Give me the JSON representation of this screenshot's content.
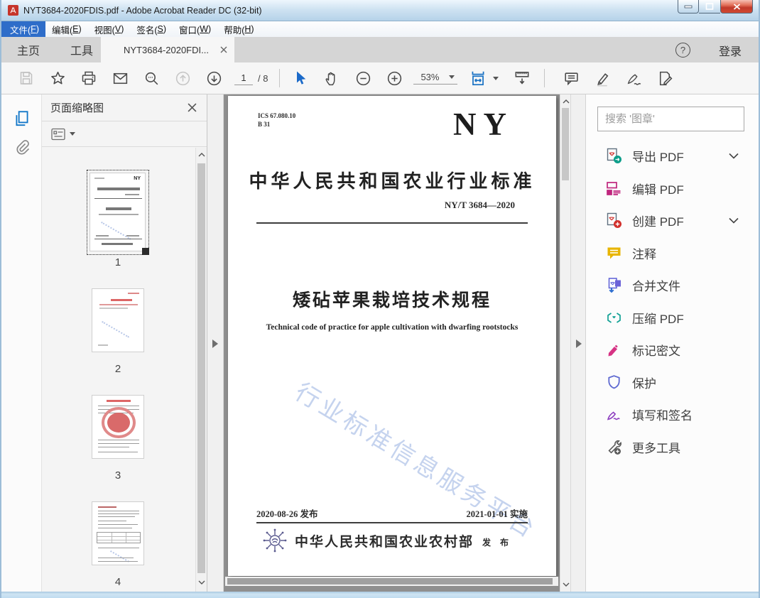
{
  "window": {
    "title": "NYT3684-2020FDIS.pdf - Adobe Acrobat Reader DC (32-bit)"
  },
  "menu": {
    "items": [
      {
        "pre": "文件(",
        "key": "F",
        "post": ")"
      },
      {
        "pre": "编辑(",
        "key": "E",
        "post": ")"
      },
      {
        "pre": "视图(",
        "key": "V",
        "post": ")"
      },
      {
        "pre": "签名(",
        "key": "S",
        "post": ")"
      },
      {
        "pre": "窗口(",
        "key": "W",
        "post": ")"
      },
      {
        "pre": "帮助(",
        "key": "H",
        "post": ")"
      }
    ]
  },
  "tabbar": {
    "home": "主页",
    "tools": "工具",
    "document_tab": "NYT3684-2020FDI...",
    "help_glyph": "?",
    "sign_in": "登录"
  },
  "toolbar": {
    "page_current": "1",
    "page_total": "/ 8",
    "zoom_level": "53%"
  },
  "left_panel": {
    "title": "页面缩略图",
    "thumbnails": [
      {
        "num": "1"
      },
      {
        "num": "2"
      },
      {
        "num": "3"
      },
      {
        "num": "4"
      }
    ]
  },
  "document_page": {
    "ics_line1": "ICS 67.080.10",
    "ics_line2": "B 31",
    "logo": "NY",
    "standard_heading": "中华人民共和国农业行业标准",
    "standard_number": "NY/T 3684—2020",
    "title_cn": "矮砧苹果栽培技术规程",
    "title_en": "Technical code of practice for apple cultivation with dwarfing rootstocks",
    "watermark": "行业标准信息服务平台",
    "issue_date": "2020-08-26 发布",
    "implement_date": "2021-01-01 实施",
    "publisher": "中华人民共和国农业农村部",
    "publish_label": "发 布"
  },
  "right_panel": {
    "search_placeholder": "搜索 '图章'",
    "tools": [
      {
        "label": "导出 PDF",
        "expandable": true
      },
      {
        "label": "编辑 PDF",
        "expandable": false
      },
      {
        "label": "创建 PDF",
        "expandable": true
      },
      {
        "label": "注释",
        "expandable": false
      },
      {
        "label": "合并文件",
        "expandable": false
      },
      {
        "label": "压缩 PDF",
        "expandable": false
      },
      {
        "label": "标记密文",
        "expandable": false
      },
      {
        "label": "保护",
        "expandable": false
      },
      {
        "label": "填写和签名",
        "expandable": false
      },
      {
        "label": "更多工具",
        "expandable": false
      }
    ]
  },
  "colors": {
    "accent_blue": "#1b6ac9",
    "menu_highlight": "#2e6dc9",
    "close_red": "#c0392a",
    "watermark_blue": "#c5d3ee",
    "seal_red": "#d96a6a"
  }
}
